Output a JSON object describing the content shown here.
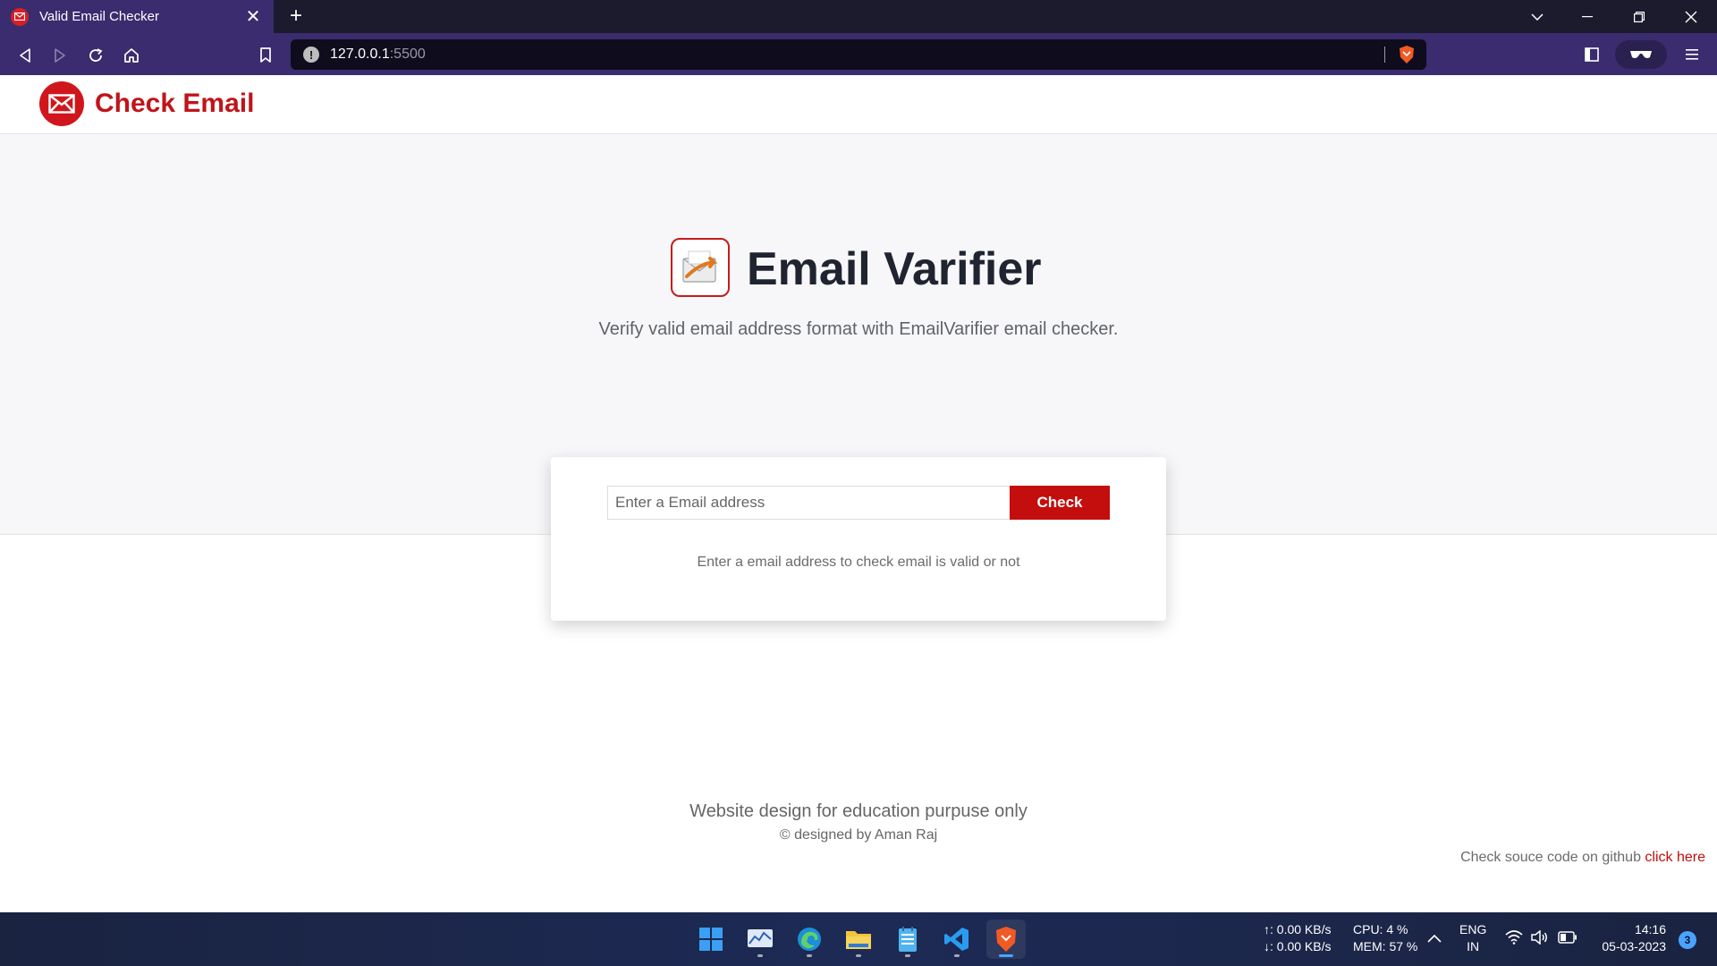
{
  "browser": {
    "tab_title": "Valid Email Checker",
    "url_host": "127.0.0.1",
    "url_port": ":5500"
  },
  "site": {
    "logo_text": "Check Email"
  },
  "hero": {
    "title": "Email Varifier",
    "subtitle": "Verify valid email address format with EmailVarifier email checker."
  },
  "checker": {
    "input_placeholder": "Enter a Email address",
    "input_value": "",
    "button_label": "Check",
    "message": "Enter a email address to check email is valid or not"
  },
  "footer": {
    "main": "Website design for education purpuse only",
    "credit": "© designed by Aman Raj",
    "github_text": "Check souce code on github ",
    "github_link": "click here"
  },
  "taskbar": {
    "apps": [
      "windows-start",
      "stock-chart-app",
      "edge-browser",
      "file-explorer",
      "notepad",
      "vscode",
      "brave-browser"
    ],
    "net_up": "↑: 0.00 KB/s",
    "net_down": "↓: 0.00 KB/s",
    "cpu": "CPU: 4 %",
    "mem": "MEM: 57 %",
    "lang": "ENG",
    "region": "IN",
    "time": "14:16",
    "date": "05-03-2023",
    "notifications": "3"
  },
  "colors": {
    "brand_red": "#c40d0d",
    "browser_purple": "#3a2c6e",
    "hero_bg": "#f7f7f9"
  }
}
